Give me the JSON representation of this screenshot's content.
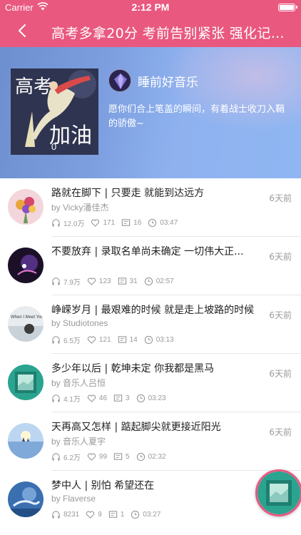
{
  "status_bar": {
    "carrier": "Carrier",
    "time": "2:12 PM"
  },
  "nav": {
    "title": "高考多拿20分 考前告别紧张 强化记忆..."
  },
  "hero": {
    "cover_text_top": "高考",
    "cover_text_bottom": "加油",
    "play_count": "0",
    "author": "睡前好音乐",
    "description": "愿你们合上笔盖的瞬间，有着战士收刀入鞘的骄傲~"
  },
  "tracks": [
    {
      "title": "路就在脚下 | 只要走 就能到达远方",
      "author": "by Vicky潘佳杰",
      "plays": "12.0万",
      "likes": "171",
      "comments": "16",
      "duration": "03:47",
      "date": "6天前"
    },
    {
      "title": "不要放弃 | 录取名单尚未确定 一切伟大正...",
      "author": "",
      "plays": "7.9万",
      "likes": "123",
      "comments": "31",
      "duration": "02:57",
      "date": "6天前"
    },
    {
      "title": "峥嵘岁月 | 最艰难的时候 就是走上坡路的时候",
      "author": "by Studiotones",
      "plays": "6.5万",
      "likes": "121",
      "comments": "14",
      "duration": "03:13",
      "date": "6天前",
      "thumb_text": "When I Meet You"
    },
    {
      "title": "多少年以后 | 乾坤未定 你我都是黑马",
      "author": "by 音乐人吕恒",
      "plays": "4.1万",
      "likes": "46",
      "comments": "3",
      "duration": "03:23",
      "date": "6天前"
    },
    {
      "title": "天再高又怎样 | 踮起脚尖就更接近阳光",
      "author": "by 音乐人夏宇",
      "plays": "6.2万",
      "likes": "99",
      "comments": "5",
      "duration": "02:32",
      "date": "6天前"
    },
    {
      "title": "梦中人 | 别怕 希望还在",
      "author": "by Flaverse",
      "plays": "8231",
      "likes": "9",
      "comments": "1",
      "duration": "03:27",
      "date": ""
    }
  ],
  "icons": {
    "back": "chevron-left-icon",
    "plays": "headphones-icon",
    "likes": "heart-icon",
    "comments": "comment-icon",
    "duration": "clock-icon"
  },
  "colors": {
    "accent": "#e9587f",
    "secondary_text": "#9a9a9a"
  }
}
